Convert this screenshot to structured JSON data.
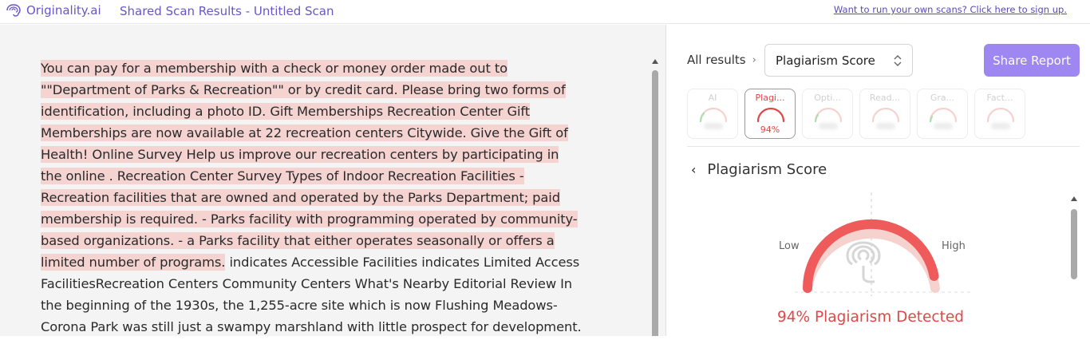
{
  "header": {
    "brand": "Originality.ai",
    "scan_title": "Shared Scan Results - Untitled Scan",
    "signup_link": "Want to run your own scans? Click here to sign up."
  },
  "document": {
    "highlighted_text": "You can pay for a membership with a check or money order made out to \"\"Department of Parks & Recreation\"\" or by credit card. Please bring two forms of identification, including a photo ID. Gift Memberships Recreation Center Gift Memberships are now available at 22 recreation centers Citywide. Give the Gift of Health! Online Survey Help us improve our recreation centers by participating in the online . Recreation Center Survey Types of Indoor Recreation Facilities - Recreation facilities that are owned and operated by the Parks Department; paid membership is required. - Parks facility with programming operated by community-based organizations. - a Parks facility that either operates seasonally or offers a limited number of programs.",
    "plain_text": " indicates Accessible Facilities indicates Limited Access FacilitiesRecreation Centers Community Centers What's Nearby Editorial Review In the beginning of the 1930s, the 1,255-acre site which is now Flushing Meadows-Corona Park was still just a swampy marshland with little prospect for development."
  },
  "results": {
    "breadcrumb": "All results",
    "selected_option": "Plagiarism Score",
    "share_button": "Share Report",
    "tabs": [
      {
        "label": "AI",
        "value": "",
        "active": false
      },
      {
        "label": "Plagi...",
        "value": "94%",
        "active": true
      },
      {
        "label": "Opti...",
        "value": "",
        "active": false
      },
      {
        "label": "Read...",
        "value": "",
        "active": false
      },
      {
        "label": "Gra...",
        "value": "",
        "active": false
      },
      {
        "label": "Fact...",
        "value": "",
        "active": false
      }
    ],
    "section_title": "Plagiarism Score",
    "gauge": {
      "low_label": "Low",
      "high_label": "High",
      "percent": 94,
      "result_text": "94% Plagiarism Detected"
    }
  },
  "colors": {
    "brand": "#6a55c8",
    "accent_button": "#9f87f2",
    "danger": "#e04848",
    "highlight": "#f4d3d1"
  }
}
